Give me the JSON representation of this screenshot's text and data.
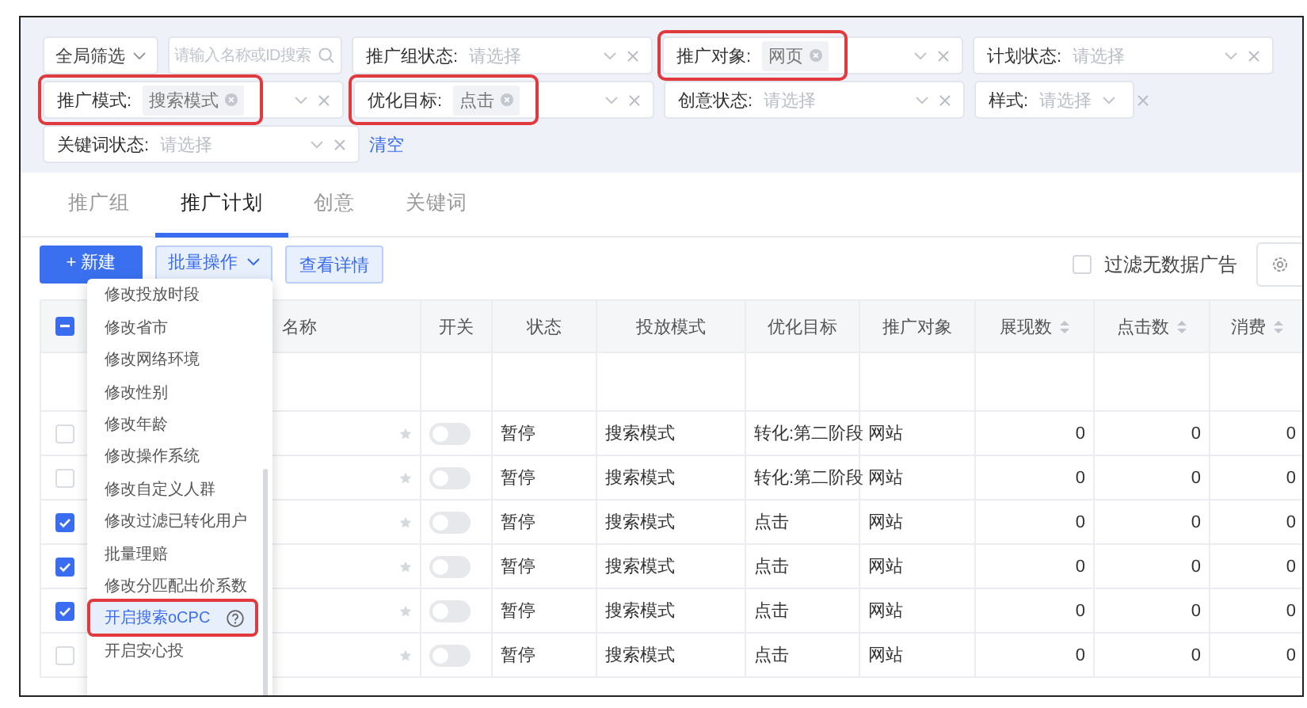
{
  "filters": [
    {
      "kind": "dropdown",
      "label": "全局筛选"
    },
    {
      "kind": "search",
      "placeholder": "请输入名称或ID搜索"
    },
    {
      "kind": "select",
      "label": "推广组状态:",
      "placeholder": "请选择",
      "highlighted": false
    },
    {
      "kind": "select",
      "label": "推广对象:",
      "tags": [
        "网页"
      ],
      "highlighted": true
    },
    {
      "kind": "select",
      "label": "计划状态:",
      "placeholder": "请选择",
      "highlighted": false
    },
    {
      "kind": "select",
      "label": "推广模式:",
      "tags": [
        "搜索模式"
      ],
      "highlighted": true
    },
    {
      "kind": "select",
      "label": "优化目标:",
      "tags": [
        "点击"
      ],
      "highlighted": true
    },
    {
      "kind": "select",
      "label": "创意状态:",
      "placeholder": "请选择",
      "highlighted": false
    },
    {
      "kind": "compact-select",
      "label": "样式:",
      "placeholder": "请选择",
      "highlighted": false
    },
    {
      "kind": "select",
      "label": "关键词状态:",
      "placeholder": "请选择",
      "highlighted": false
    }
  ],
  "clear_link": "清空",
  "tabs": [
    {
      "label": "推广组",
      "selected": false
    },
    {
      "label": "推广计划",
      "selected": true
    },
    {
      "label": "创意",
      "selected": false
    },
    {
      "label": "关键词",
      "selected": false
    }
  ],
  "toolbar": {
    "buttons": [
      {
        "label": "+ 新建",
        "kind": "primary"
      },
      {
        "label": "批量操作",
        "kind": "dropdown"
      },
      {
        "label": "查看详情",
        "kind": "secondary"
      }
    ],
    "filter_no_data": {
      "label": "过滤无数据广告",
      "checked": false
    }
  },
  "table": {
    "select_all": {
      "indeterminate": true
    },
    "columns": [
      {
        "label": "名称",
        "sortable": false
      },
      {
        "label": "开关",
        "sortable": false
      },
      {
        "label": "状态",
        "sortable": false
      },
      {
        "label": "投放模式",
        "sortable": false
      },
      {
        "label": "优化目标",
        "sortable": false
      },
      {
        "label": "推广对象",
        "sortable": false
      },
      {
        "label": "展现数",
        "sortable": true
      },
      {
        "label": "点击数",
        "sortable": true
      },
      {
        "label": "消费",
        "sortable": true
      }
    ],
    "rows": [
      {
        "checked": false,
        "switch_on": false,
        "status": "暂停",
        "mode": "搜索模式",
        "goal": "转化:第二阶段",
        "object": "网站",
        "impressions": "0",
        "clicks": "0",
        "cost": "0"
      },
      {
        "checked": false,
        "switch_on": false,
        "status": "暂停",
        "mode": "搜索模式",
        "goal": "转化:第二阶段",
        "object": "网站",
        "impressions": "0",
        "clicks": "0",
        "cost": "0"
      },
      {
        "checked": true,
        "switch_on": false,
        "status": "暂停",
        "mode": "搜索模式",
        "goal": "点击",
        "object": "网站",
        "impressions": "0",
        "clicks": "0",
        "cost": "0"
      },
      {
        "checked": true,
        "switch_on": false,
        "status": "暂停",
        "mode": "搜索模式",
        "goal": "点击",
        "object": "网站",
        "impressions": "0",
        "clicks": "0",
        "cost": "0"
      },
      {
        "checked": true,
        "switch_on": false,
        "status": "暂停",
        "mode": "搜索模式",
        "goal": "点击",
        "object": "网站",
        "impressions": "0",
        "clicks": "0",
        "cost": "0"
      },
      {
        "checked": false,
        "switch_on": false,
        "status": "暂停",
        "mode": "搜索模式",
        "goal": "点击",
        "object": "网站",
        "impressions": "0",
        "clicks": "0",
        "cost": "0"
      }
    ]
  },
  "batch_menu": {
    "items": [
      {
        "label": "修改投放时段",
        "hovered": false,
        "highlighted": false,
        "help": false
      },
      {
        "label": "修改省市",
        "hovered": false,
        "highlighted": false,
        "help": false
      },
      {
        "label": "修改网络环境",
        "hovered": false,
        "highlighted": false,
        "help": false
      },
      {
        "label": "修改性别",
        "hovered": false,
        "highlighted": false,
        "help": false
      },
      {
        "label": "修改年龄",
        "hovered": false,
        "highlighted": false,
        "help": false
      },
      {
        "label": "修改操作系统",
        "hovered": false,
        "highlighted": false,
        "help": false
      },
      {
        "label": "修改自定义人群",
        "hovered": false,
        "highlighted": false,
        "help": false
      },
      {
        "label": "修改过滤已转化用户",
        "hovered": false,
        "highlighted": false,
        "help": false
      },
      {
        "label": "批量理赔",
        "hovered": false,
        "highlighted": false,
        "help": false
      },
      {
        "label": "修改分匹配出价系数",
        "hovered": false,
        "highlighted": false,
        "help": false
      },
      {
        "label": "开启搜索oCPC",
        "hovered": true,
        "highlighted": true,
        "help": true
      },
      {
        "label": "开启安心投",
        "hovered": false,
        "highlighted": false,
        "help": false
      }
    ]
  }
}
